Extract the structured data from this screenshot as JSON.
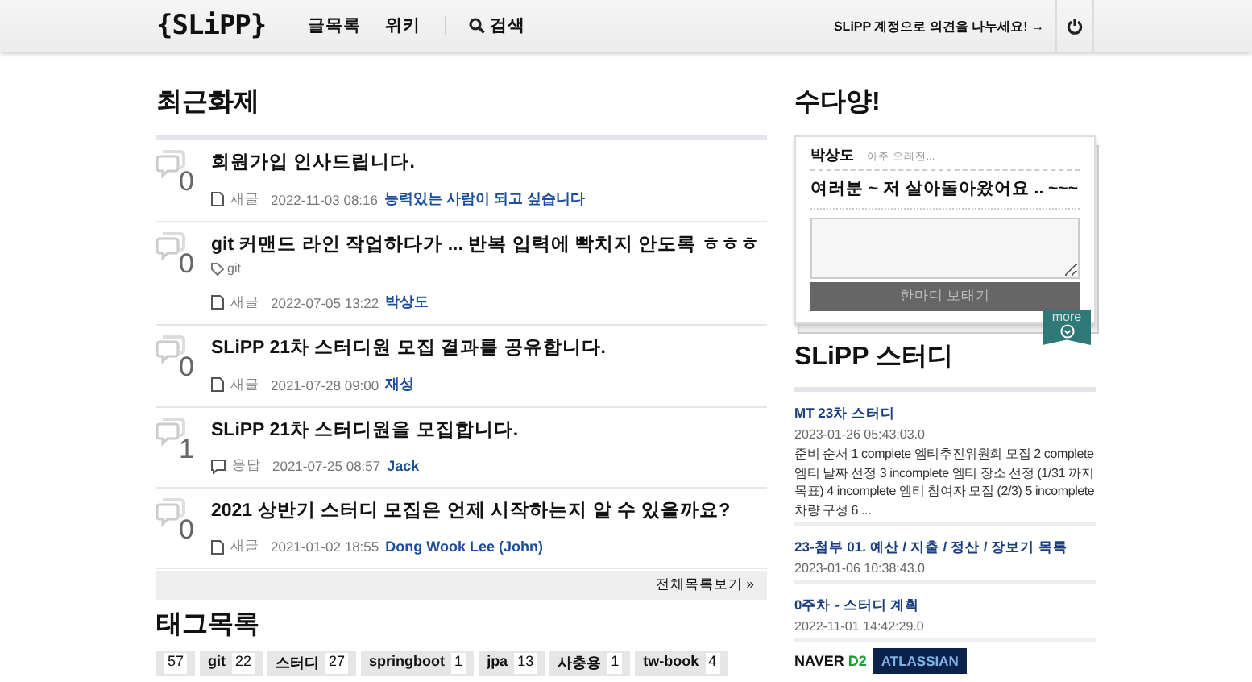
{
  "header": {
    "logo": "{SLiPP}",
    "nav": [
      {
        "label": "글목록",
        "kind": "link"
      },
      {
        "label": "위키",
        "kind": "link"
      },
      {
        "label": "검색",
        "kind": "search"
      }
    ],
    "login": "SLiPP 계정으로 의견을 나누세요! →"
  },
  "recent": {
    "title": "최근화제",
    "posts": [
      {
        "count": "0",
        "title": "회원가입 인사드립니다.",
        "type": "새글",
        "kind": "new",
        "date": "2022-11-03 08:16",
        "author": "능력있는 사람이 되고 싶습니다"
      },
      {
        "count": "0",
        "title": "git 커맨드 라인 작업하다가 ... 반복 입력에 빡치지 안도록 ㅎㅎㅎ",
        "tags": [
          "git"
        ],
        "type": "새글",
        "kind": "new",
        "date": "2022-07-05 13:22",
        "author": "박상도"
      },
      {
        "count": "0",
        "title": "SLiPP 21차 스터디원 모집 결과를 공유합니다.",
        "type": "새글",
        "kind": "new",
        "date": "2021-07-28 09:00",
        "author": "재성"
      },
      {
        "count": "1",
        "title": "SLiPP 21차 스터디원을 모집합니다.",
        "type": "응답",
        "kind": "reply",
        "date": "2021-07-25 08:57",
        "author": "Jack"
      },
      {
        "count": "0",
        "title": "2021 상반기 스터디 모집은 언제 시작하는지 알 수 있을까요?",
        "type": "새글",
        "kind": "new",
        "date": "2021-01-02 18:55",
        "author": "Dong Wook Lee (John)"
      }
    ],
    "more": "전체목록보기 »"
  },
  "tags": {
    "title": "태그목록",
    "items": [
      {
        "count": "57"
      },
      {
        "name": "git",
        "count": "22"
      },
      {
        "name": "스터디",
        "count": "27"
      },
      {
        "name": "springboot",
        "count": "1"
      },
      {
        "name": "jpa",
        "count": "13"
      },
      {
        "name": "사충용",
        "count": "1"
      },
      {
        "name": "tw-book",
        "count": "4"
      }
    ]
  },
  "chat": {
    "title": "수다양!",
    "author": "박상도",
    "time": "아주 오래전...",
    "message": "여러분 ~ 저 살아돌아왔어요 .. ~~~",
    "submit": "한마디 보태기",
    "more": "more"
  },
  "study": {
    "title": "SLiPP 스터디",
    "items": [
      {
        "title": "MT 23차 스터디",
        "date": "2023-01-26 05:43:03.0",
        "summary": "준비 순서 1 complete 엠티추진위원회 모집 2 complete 엠티 날짜 선정 3 incomplete 엠티 장소 선정 (1/31 까지 목표) 4 incomplete 엠티 참여자 모집 (2/3) 5 incomplete 차량 구성 6 ..."
      },
      {
        "title": "23-첨부 01. 예산 / 지출 / 정산 / 장보기 목록",
        "date": "2023-01-06 10:38:43.0"
      },
      {
        "title": "0주차 - 스터디 계획",
        "date": "2022-11-01 14:42:29.0"
      }
    ]
  },
  "sponsors": [
    {
      "name": "NAVER",
      "suffix": "D2",
      "kind": "naver"
    },
    {
      "name": "ATLASSIAN",
      "kind": "atlassian"
    }
  ]
}
